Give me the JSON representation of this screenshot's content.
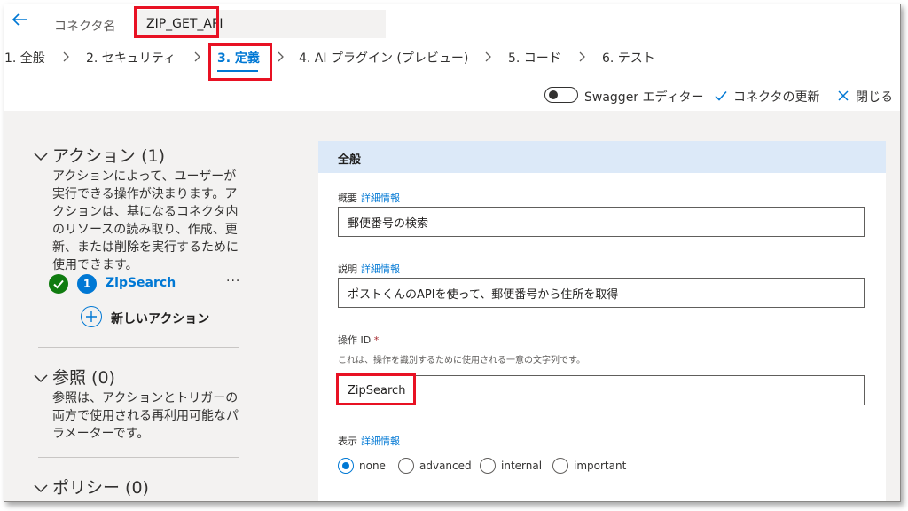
{
  "header": {
    "back_icon": "back-arrow-icon",
    "connector_label": "コネクタ名",
    "connector_name": "ZIP_GET_API"
  },
  "steps": [
    {
      "label": "1. 全般"
    },
    {
      "label": "2. セキュリティ"
    },
    {
      "label": "3. 定義",
      "active": true
    },
    {
      "label": "4. AI プラグイン (プレビュー)"
    },
    {
      "label": "5. コード"
    },
    {
      "label": "6. テスト"
    }
  ],
  "toolbar": {
    "swagger_label": "Swagger エディター",
    "swagger_on": false,
    "update_label": "コネクタの更新",
    "close_label": "閉じる"
  },
  "left": {
    "actions_header": "アクション (1)",
    "actions_desc": "アクションによって、ユーザーが実行できる操作が決まります。アクションは、基になるコネクタ内のリソースの読み取り、作成、更新、または削除を実行するために使用できます。",
    "action_item": {
      "number": "1",
      "name": "ZipSearch",
      "more": "···"
    },
    "new_action_label": "新しいアクション",
    "refs_header": "参照 (0)",
    "refs_desc": "参照は、アクションとトリガーの両方で使用される再利用可能なパラメーターです。",
    "policies_header": "ポリシー (0)"
  },
  "card": {
    "title": "全般",
    "summary_label": "概要",
    "summary_link": "詳細情報",
    "summary_value": "郵便番号の検索",
    "description_label": "説明",
    "description_link": "詳細情報",
    "description_value": "ポストくんのAPIを使って、郵便番号から住所を取得",
    "operation_id_label": "操作 ID",
    "operation_id_required": "*",
    "operation_id_hint": "これは、操作を識別するために使用される一意の文字列です。",
    "operation_id_value": "ZipSearch",
    "visibility_label": "表示",
    "visibility_link": "詳細情報",
    "visibility_options": [
      "none",
      "advanced",
      "internal",
      "important"
    ],
    "visibility_selected": "none"
  },
  "colors": {
    "accent": "#0078d4",
    "highlight": "#e81123",
    "success": "#107c10",
    "card_header": "#dce9f8",
    "panel_bg": "#f3f2f1"
  }
}
